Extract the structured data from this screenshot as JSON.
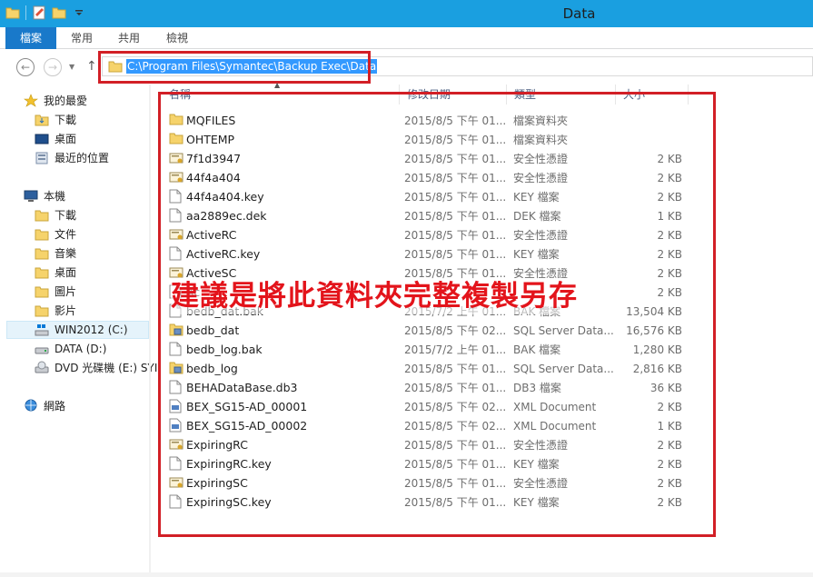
{
  "window": {
    "title": "Data"
  },
  "ribbon": {
    "tabs": [
      {
        "label": "檔案"
      },
      {
        "label": "常用"
      },
      {
        "label": "共用"
      },
      {
        "label": "檢視"
      }
    ]
  },
  "address": {
    "path": "C:\\Program Files\\Symantec\\Backup Exec\\Data"
  },
  "sidebar": {
    "items": [
      {
        "label": "我的最愛",
        "icon": "star-icon"
      },
      {
        "label": "下載",
        "icon": "folder-icon"
      },
      {
        "label": "桌面",
        "icon": "desktop-icon"
      },
      {
        "label": "最近的位置",
        "icon": "recent-icon"
      },
      {
        "label": "本機",
        "icon": "computer-icon"
      },
      {
        "label": "下載",
        "icon": "folder-icon"
      },
      {
        "label": "文件",
        "icon": "folder-icon"
      },
      {
        "label": "音樂",
        "icon": "folder-icon"
      },
      {
        "label": "桌面",
        "icon": "folder-icon"
      },
      {
        "label": "圖片",
        "icon": "folder-icon"
      },
      {
        "label": "影片",
        "icon": "folder-icon"
      },
      {
        "label": "WIN2012 (C:)",
        "icon": "drive-icon"
      },
      {
        "label": "DATA (D:)",
        "icon": "drive-icon"
      },
      {
        "label": "DVD 光碟機 (E:) SYI",
        "icon": "dvd-icon"
      },
      {
        "label": "網路",
        "icon": "network-icon"
      }
    ]
  },
  "columns": {
    "name": "名稱",
    "date": "修改日期",
    "type": "類型",
    "size": "大小"
  },
  "files": [
    {
      "name": "MQFILES",
      "date": "2015/8/5 下午 01...",
      "type": "檔案資料夾",
      "size": "",
      "icon": "folder"
    },
    {
      "name": "OHTEMP",
      "date": "2015/8/5 下午 01...",
      "type": "檔案資料夾",
      "size": "",
      "icon": "folder"
    },
    {
      "name": "7f1d3947",
      "date": "2015/8/5 下午 01...",
      "type": "安全性憑證",
      "size": "2 KB",
      "icon": "cert"
    },
    {
      "name": "44f4a404",
      "date": "2015/8/5 下午 01...",
      "type": "安全性憑證",
      "size": "2 KB",
      "icon": "cert"
    },
    {
      "name": "44f4a404.key",
      "date": "2015/8/5 下午 01...",
      "type": "KEY 檔案",
      "size": "2 KB",
      "icon": "file"
    },
    {
      "name": "aa2889ec.dek",
      "date": "2015/8/5 下午 01...",
      "type": "DEK 檔案",
      "size": "1 KB",
      "icon": "file"
    },
    {
      "name": "ActiveRC",
      "date": "2015/8/5 下午 01...",
      "type": "安全性憑證",
      "size": "2 KB",
      "icon": "cert"
    },
    {
      "name": "ActiveRC.key",
      "date": "2015/8/5 下午 01...",
      "type": "KEY 檔案",
      "size": "2 KB",
      "icon": "file"
    },
    {
      "name": "ActiveSC",
      "date": "2015/8/5 下午 01...",
      "type": "安全性憑證",
      "size": "2 KB",
      "icon": "cert"
    },
    {
      "name": "Ac",
      "date": "",
      "type": "",
      "size": "2 KB",
      "icon": "file"
    },
    {
      "name": "bedb_dat.bak",
      "date": "2015/7/2 上午 01...",
      "type": "BAK 檔案",
      "size": "13,504 KB",
      "icon": "file"
    },
    {
      "name": "bedb_dat",
      "date": "2015/8/5 下午 02...",
      "type": "SQL Server Data...",
      "size": "16,576 KB",
      "icon": "sql"
    },
    {
      "name": "bedb_log.bak",
      "date": "2015/7/2 上午 01...",
      "type": "BAK 檔案",
      "size": "1,280 KB",
      "icon": "file"
    },
    {
      "name": "bedb_log",
      "date": "2015/8/5 下午 01...",
      "type": "SQL Server Data...",
      "size": "2,816 KB",
      "icon": "sql"
    },
    {
      "name": "BEHADataBase.db3",
      "date": "2015/8/5 下午 01...",
      "type": "DB3 檔案",
      "size": "36 KB",
      "icon": "file"
    },
    {
      "name": "BEX_SG15-AD_00001",
      "date": "2015/8/5 下午 02...",
      "type": "XML Document",
      "size": "2 KB",
      "icon": "xml"
    },
    {
      "name": "BEX_SG15-AD_00002",
      "date": "2015/8/5 下午 02...",
      "type": "XML Document",
      "size": "1 KB",
      "icon": "xml"
    },
    {
      "name": "ExpiringRC",
      "date": "2015/8/5 下午 01...",
      "type": "安全性憑證",
      "size": "2 KB",
      "icon": "cert"
    },
    {
      "name": "ExpiringRC.key",
      "date": "2015/8/5 下午 01...",
      "type": "KEY 檔案",
      "size": "2 KB",
      "icon": "file"
    },
    {
      "name": "ExpiringSC",
      "date": "2015/8/5 下午 01...",
      "type": "安全性憑證",
      "size": "2 KB",
      "icon": "cert"
    },
    {
      "name": "ExpiringSC.key",
      "date": "2015/8/5 下午 01...",
      "type": "KEY 檔案",
      "size": "2 KB",
      "icon": "file"
    }
  ],
  "annotation": {
    "text": "建議是將此資料夾完整複製另存"
  },
  "colors": {
    "titlebar": "#1a9fe0",
    "file_tab": "#1979ca",
    "highlight_box": "#d21f26",
    "annotation_text": "#e3141b",
    "selection": "#3399ff"
  }
}
